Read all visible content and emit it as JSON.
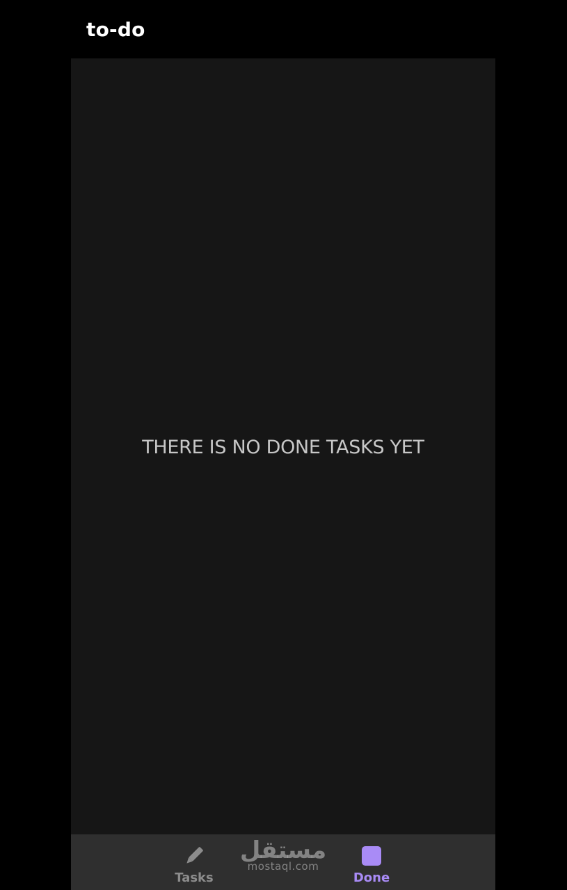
{
  "app_bar": {
    "title": "to-do"
  },
  "content": {
    "empty_message": "THERE IS NO DONE TASKS YET"
  },
  "bottom_nav": {
    "items": [
      {
        "label": "Tasks",
        "icon": "pencil-icon",
        "active": false
      },
      {
        "label": "Done",
        "icon": "done-square-icon",
        "active": true
      }
    ]
  },
  "watermark": {
    "arabic": "مستقل",
    "latin": "mostaql.com"
  },
  "colors": {
    "background": "#000000",
    "content_background": "#161616",
    "nav_background": "#2f2f2f",
    "accent": "#a98bf6",
    "inactive": "#8c8c8c",
    "message_text": "#c7c7c7"
  }
}
